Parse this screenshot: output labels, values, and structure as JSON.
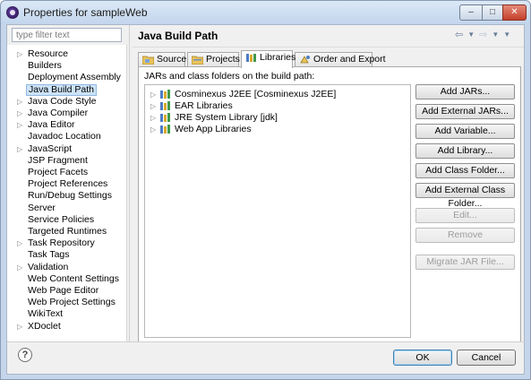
{
  "window": {
    "title": "Properties for sampleWeb"
  },
  "filter": {
    "placeholder": "type filter text"
  },
  "nav": {
    "items": [
      {
        "label": "Resource",
        "expandable": true
      },
      {
        "label": "Builders",
        "expandable": false
      },
      {
        "label": "Deployment Assembly",
        "expandable": false
      },
      {
        "label": "Java Build Path",
        "expandable": false,
        "selected": true
      },
      {
        "label": "Java Code Style",
        "expandable": true
      },
      {
        "label": "Java Compiler",
        "expandable": true
      },
      {
        "label": "Java Editor",
        "expandable": true
      },
      {
        "label": "Javadoc Location",
        "expandable": false
      },
      {
        "label": "JavaScript",
        "expandable": true
      },
      {
        "label": "JSP Fragment",
        "expandable": false
      },
      {
        "label": "Project Facets",
        "expandable": false
      },
      {
        "label": "Project References",
        "expandable": false
      },
      {
        "label": "Run/Debug Settings",
        "expandable": false
      },
      {
        "label": "Server",
        "expandable": false
      },
      {
        "label": "Service Policies",
        "expandable": false
      },
      {
        "label": "Targeted Runtimes",
        "expandable": false
      },
      {
        "label": "Task Repository",
        "expandable": true
      },
      {
        "label": "Task Tags",
        "expandable": false
      },
      {
        "label": "Validation",
        "expandable": true
      },
      {
        "label": "Web Content Settings",
        "expandable": false
      },
      {
        "label": "Web Page Editor",
        "expandable": false
      },
      {
        "label": "Web Project Settings",
        "expandable": false
      },
      {
        "label": "WikiText",
        "expandable": false
      },
      {
        "label": "XDoclet",
        "expandable": true
      }
    ]
  },
  "page": {
    "title": "Java Build Path"
  },
  "tabs": [
    {
      "label": "Source",
      "active": false
    },
    {
      "label": "Projects",
      "active": false
    },
    {
      "label": "Libraries",
      "active": true
    },
    {
      "label": "Order and Export",
      "active": false
    }
  ],
  "panel": {
    "caption": "JARs and class folders on the build path:",
    "libraries": [
      {
        "label": "Cosminexus J2EE [Cosminexus J2EE]"
      },
      {
        "label": "EAR Libraries"
      },
      {
        "label": "JRE System Library [jdk]"
      },
      {
        "label": "Web App Libraries"
      }
    ]
  },
  "buttons": [
    {
      "label": "Add JARs...",
      "enabled": true
    },
    {
      "label": "Add External JARs...",
      "enabled": true
    },
    {
      "label": "Add Variable...",
      "enabled": true
    },
    {
      "label": "Add Library...",
      "enabled": true
    },
    {
      "label": "Add Class Folder...",
      "enabled": true
    },
    {
      "label": "Add External Class Folder...",
      "enabled": true
    },
    {
      "label": "Edit...",
      "enabled": false
    },
    {
      "label": "Remove",
      "enabled": false
    },
    {
      "label": "Migrate JAR File...",
      "enabled": false
    }
  ],
  "dialog": {
    "ok_label": "OK",
    "cancel_label": "Cancel",
    "help_glyph": "?"
  },
  "colors": {
    "selection": "#cde3f7",
    "titlebar": "#c2d5ec",
    "close_button": "#c43f2b"
  }
}
